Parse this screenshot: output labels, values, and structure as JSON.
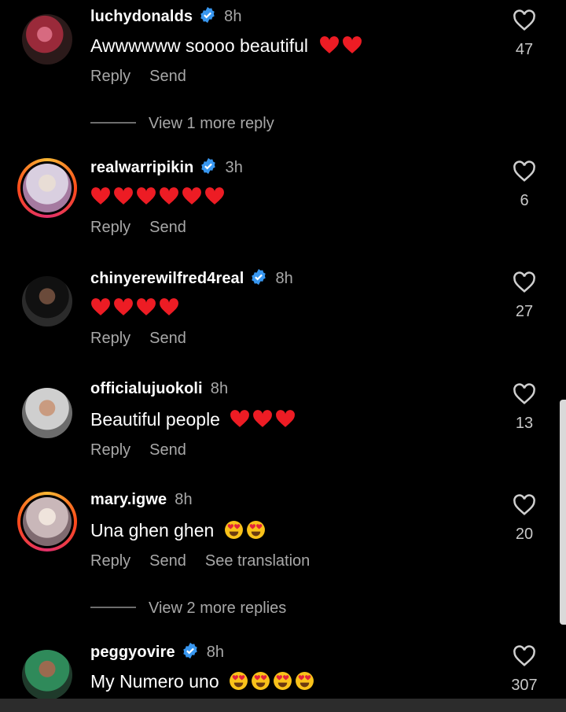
{
  "comments": [
    {
      "user": "luchydonalds",
      "verified": true,
      "time": "8h",
      "text": "Awwwwww soooo beautiful",
      "emoji": "heart",
      "emoji_count": 2,
      "actions": [
        "Reply",
        "Send"
      ],
      "likes": "47"
    },
    {
      "user": "realwarripikin",
      "verified": true,
      "time": "3h",
      "text": "",
      "emoji": "heart",
      "emoji_count": 6,
      "actions": [
        "Reply",
        "Send"
      ],
      "likes": "6"
    },
    {
      "user": "chinyerewilfred4real",
      "verified": true,
      "time": "8h",
      "text": "",
      "emoji": "heart",
      "emoji_count": 4,
      "actions": [
        "Reply",
        "Send"
      ],
      "likes": "27"
    },
    {
      "user": "officialujuokoli",
      "verified": false,
      "time": "8h",
      "text": "Beautiful people",
      "emoji": "heart",
      "emoji_count": 3,
      "actions": [
        "Reply",
        "Send"
      ],
      "likes": "13"
    },
    {
      "user": "mary.igwe",
      "verified": false,
      "time": "8h",
      "text": "Una ghen ghen",
      "emoji": "heart-eyes",
      "emoji_count": 2,
      "actions": [
        "Reply",
        "Send",
        "See translation"
      ],
      "likes": "20"
    },
    {
      "user": "peggyovire",
      "verified": true,
      "time": "8h",
      "text": "My Numero uno",
      "emoji": "heart-eyes",
      "emoji_count": 4,
      "actions": [],
      "likes": "307"
    }
  ],
  "more_replies": [
    "View 1 more reply",
    "View 2 more replies"
  ],
  "colors": {
    "verified": "#3897f0",
    "heart": "#ed1c24",
    "muted": "#a8a8a8"
  },
  "icons": {
    "like": "heart-outline-icon",
    "verified": "verified-badge-icon"
  }
}
